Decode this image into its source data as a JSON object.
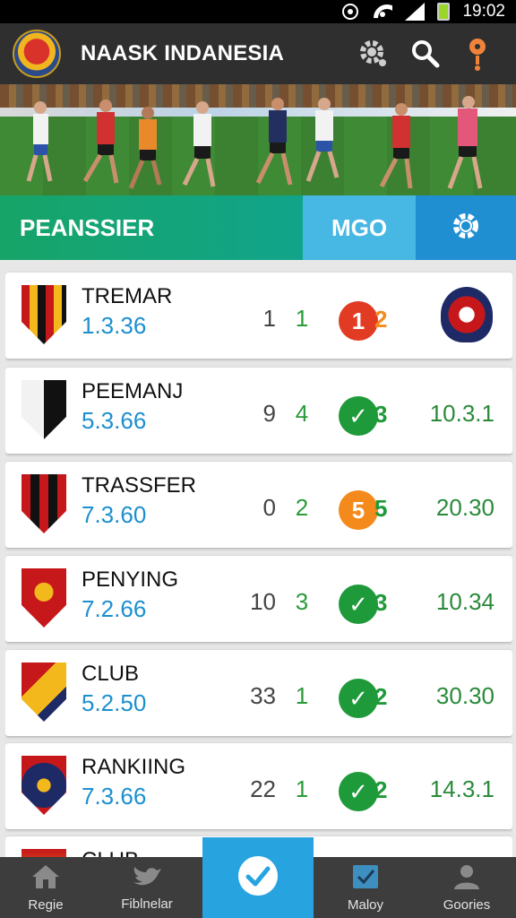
{
  "status_bar": {
    "time": "19:02",
    "icons": [
      "nfc-icon",
      "wifi-icon",
      "signal-icon",
      "battery-icon"
    ]
  },
  "app_bar": {
    "title": "NAASK INDANESIA",
    "logo": "club-crest-logo",
    "actions": [
      "settings-gear-icon",
      "search-icon",
      "location-pin-icon"
    ]
  },
  "hero": {
    "image": "football-players-match-photo"
  },
  "tabs": {
    "main_label": "PEANSSIER",
    "secondary_label": "MGO",
    "icon": "settings-gear-icon"
  },
  "colors": {
    "green_tab": "#17a468",
    "light_blue_tab": "#47b7e3",
    "blue_tab": "#1f8fd2",
    "code_blue": "#1d8fcf",
    "score_green": "#2a9b3a",
    "badge_red": "#e23b24",
    "badge_orange": "#f48a1c",
    "badge_green": "#1f9a3a",
    "nav_active": "#27a4e0"
  },
  "rows": [
    {
      "name": "TREMAR",
      "code": "1.3.36",
      "a": "1",
      "b": "1",
      "badge": "1",
      "badge_type": "red",
      "badge_next": "2",
      "badge_next_color": "#f48a1c",
      "odds": "",
      "right_crest": true
    },
    {
      "name": "PEEMANJ",
      "code": "5.3.66",
      "a": "9",
      "b": "4",
      "badge": "✓",
      "badge_type": "green",
      "badge_next": "3",
      "badge_next_color": "#1f9a3a",
      "odds": "10.3.1",
      "right_crest": false
    },
    {
      "name": "TRASSFER",
      "code": "7.3.60",
      "a": "0",
      "b": "2",
      "badge": "5",
      "badge_type": "orange",
      "badge_next": "5",
      "badge_next_color": "#1f9a3a",
      "odds": "20.30",
      "right_crest": false
    },
    {
      "name": "PENYING",
      "code": "7.2.66",
      "a": "10",
      "b": "3",
      "badge": "✓",
      "badge_type": "green",
      "badge_next": "3",
      "badge_next_color": "#1f9a3a",
      "odds": "10.34",
      "right_crest": false
    },
    {
      "name": "CLUB",
      "code": "5.2.50",
      "a": "33",
      "b": "1",
      "badge": "✓",
      "badge_type": "green",
      "badge_next": "2",
      "badge_next_color": "#1f9a3a",
      "odds": "30.30",
      "right_crest": false
    },
    {
      "name": "RANKIING",
      "code": "7.3.66",
      "a": "22",
      "b": "1",
      "badge": "✓",
      "badge_type": "green",
      "badge_next": "2",
      "badge_next_color": "#1f9a3a",
      "odds": "14.3.1",
      "right_crest": false
    },
    {
      "name": "CLUB",
      "code": "",
      "a": "",
      "b": "",
      "badge": "",
      "badge_type": "none",
      "badge_next": "",
      "badge_next_color": "#1f9a3a",
      "odds": "",
      "right_crest": true
    }
  ],
  "bottom_nav": [
    {
      "label": "Regie",
      "icon": "home-icon"
    },
    {
      "label": "Fiblnelar",
      "icon": "bird-icon"
    },
    {
      "label": "",
      "icon": "checkmark-icon"
    },
    {
      "label": "Maloy",
      "icon": "checkbox-icon"
    },
    {
      "label": "Goories",
      "icon": "person-icon"
    }
  ]
}
